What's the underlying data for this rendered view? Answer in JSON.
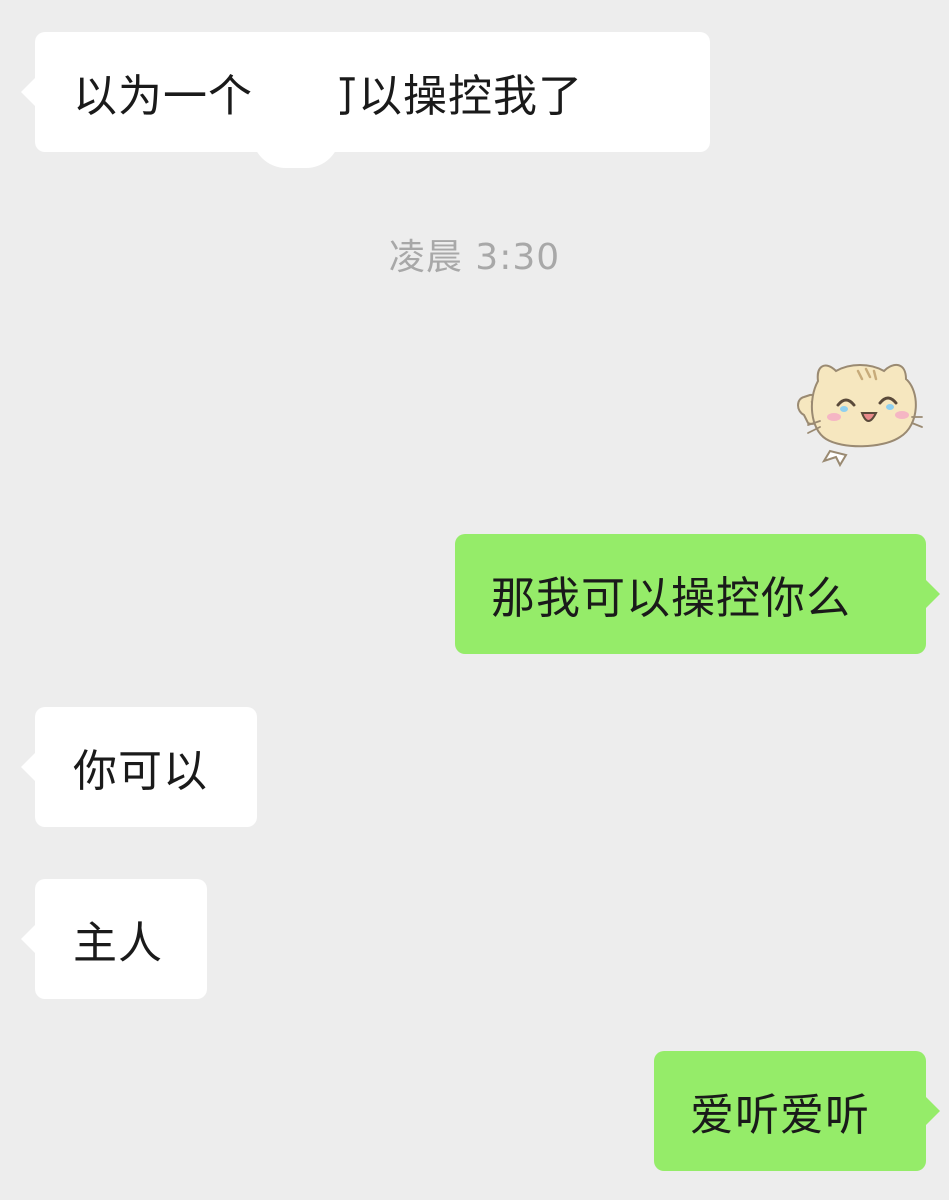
{
  "conversation": {
    "timestamp": "凌晨 3:30",
    "messages": [
      {
        "side": "left",
        "text": "以为一个 就可以操控我了"
      },
      {
        "side": "right",
        "type": "sticker",
        "icon": "smiling-cat-sticker-icon"
      },
      {
        "side": "right",
        "text": "那我可以操控你么"
      },
      {
        "side": "left",
        "text": "你可以"
      },
      {
        "side": "left",
        "text": "主人"
      },
      {
        "side": "right",
        "text": "爱听爱听"
      }
    ]
  },
  "colors": {
    "background": "#ededed",
    "incoming_bubble": "#ffffff",
    "outgoing_bubble": "#95ec69",
    "timestamp_text": "#a8a8a8"
  }
}
